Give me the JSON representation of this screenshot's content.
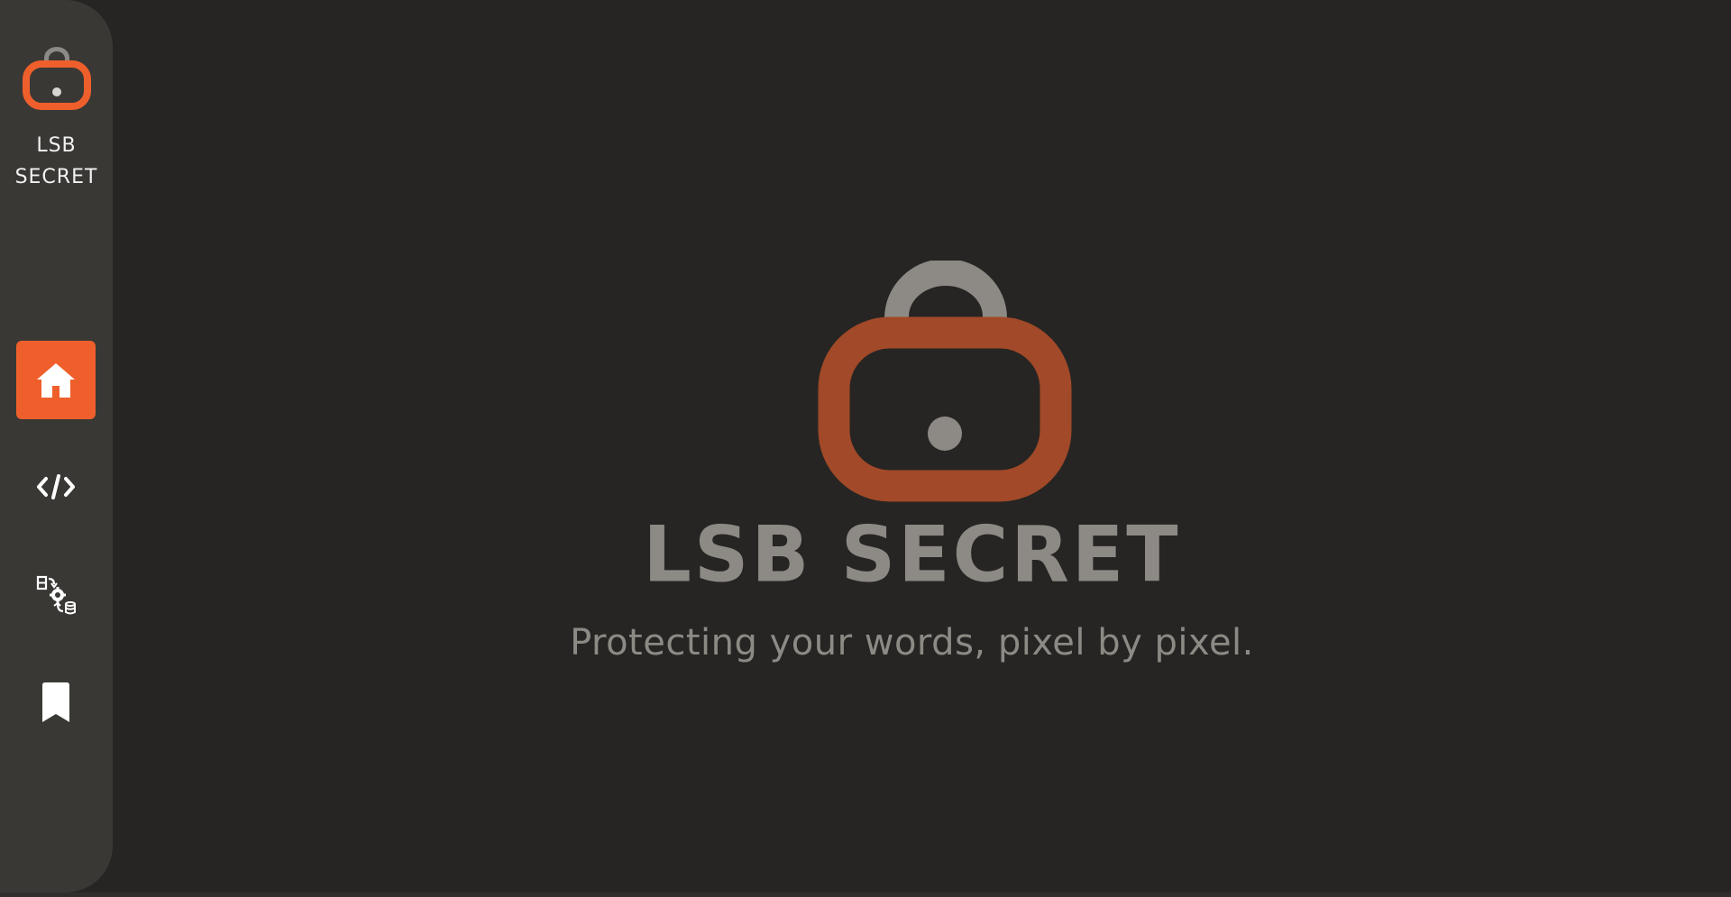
{
  "app": {
    "brand_line1": "LSB",
    "brand_line2": "SECRET",
    "accent_color": "#ef5f2c",
    "logo_shackle_color": "#8d8a85"
  },
  "sidebar": {
    "items": [
      {
        "name": "home",
        "icon": "home-icon",
        "active": true
      },
      {
        "name": "code",
        "icon": "code-icon",
        "active": false
      },
      {
        "name": "process",
        "icon": "data-process-icon",
        "active": false
      },
      {
        "name": "bookmark",
        "icon": "bookmark-icon",
        "active": false
      }
    ]
  },
  "hero": {
    "title": "LSB SECRET",
    "tagline": "Protecting your words, pixel by pixel."
  }
}
